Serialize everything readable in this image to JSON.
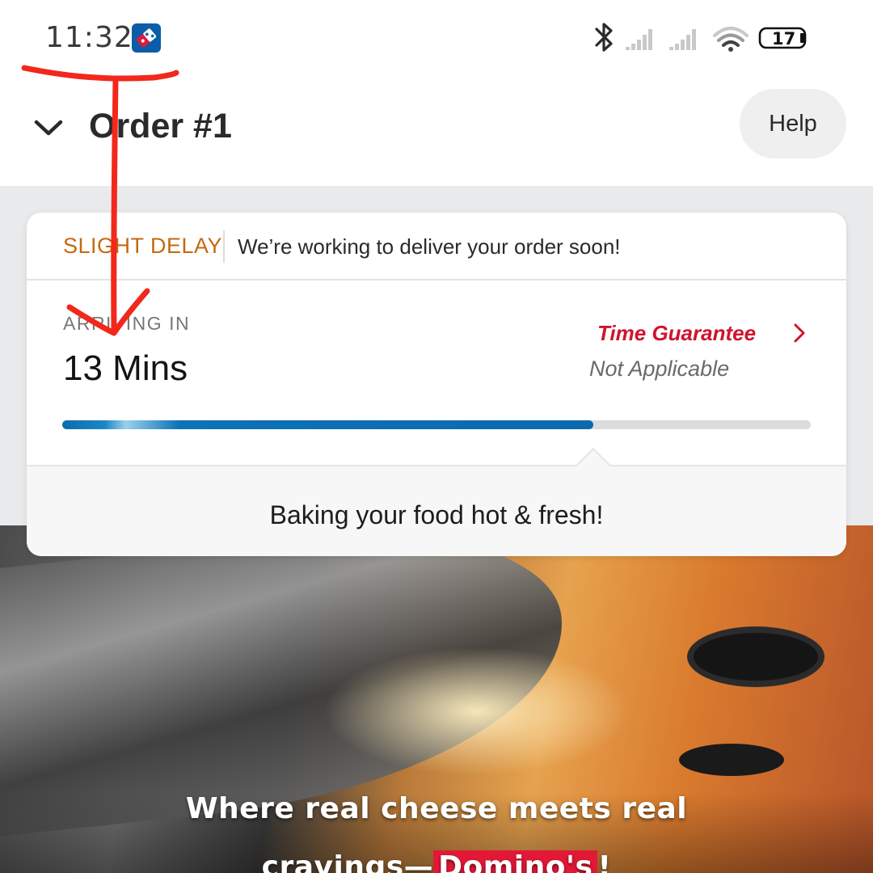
{
  "status_bar": {
    "time": "11:32",
    "app_badge_icon": "dominos-logo-icon",
    "battery_level": "17",
    "icons": [
      "bluetooth-icon",
      "signal-icon",
      "signal-icon",
      "wifi-icon",
      "battery-icon"
    ]
  },
  "header": {
    "title": "Order #1",
    "back_icon": "chevron-down-icon",
    "help_label": "Help"
  },
  "delay_banner": {
    "tag": "SLIGHT DELAY",
    "message": "We’re working to deliver your order soon!"
  },
  "eta": {
    "label": "ARRIVING IN",
    "value": "13 Mins",
    "progress_fraction": 0.71
  },
  "time_guarantee": {
    "label": "Time Guarantee",
    "status": "Not Applicable",
    "chevron_icon": "chevron-right-icon"
  },
  "order_stage": {
    "text": "Baking your food hot & fresh!"
  },
  "promo_banner": {
    "line1": "Where real cheese meets real",
    "line2_prefix": "cravings—",
    "brand": "Domino's",
    "line2_suffix": "!"
  },
  "colors": {
    "delay_tag": "#c4690f",
    "guarantee_red": "#d0142c",
    "progress_blue": "#0b6aae",
    "annotation_red": "#f2281c",
    "brand_red": "#e31837"
  }
}
